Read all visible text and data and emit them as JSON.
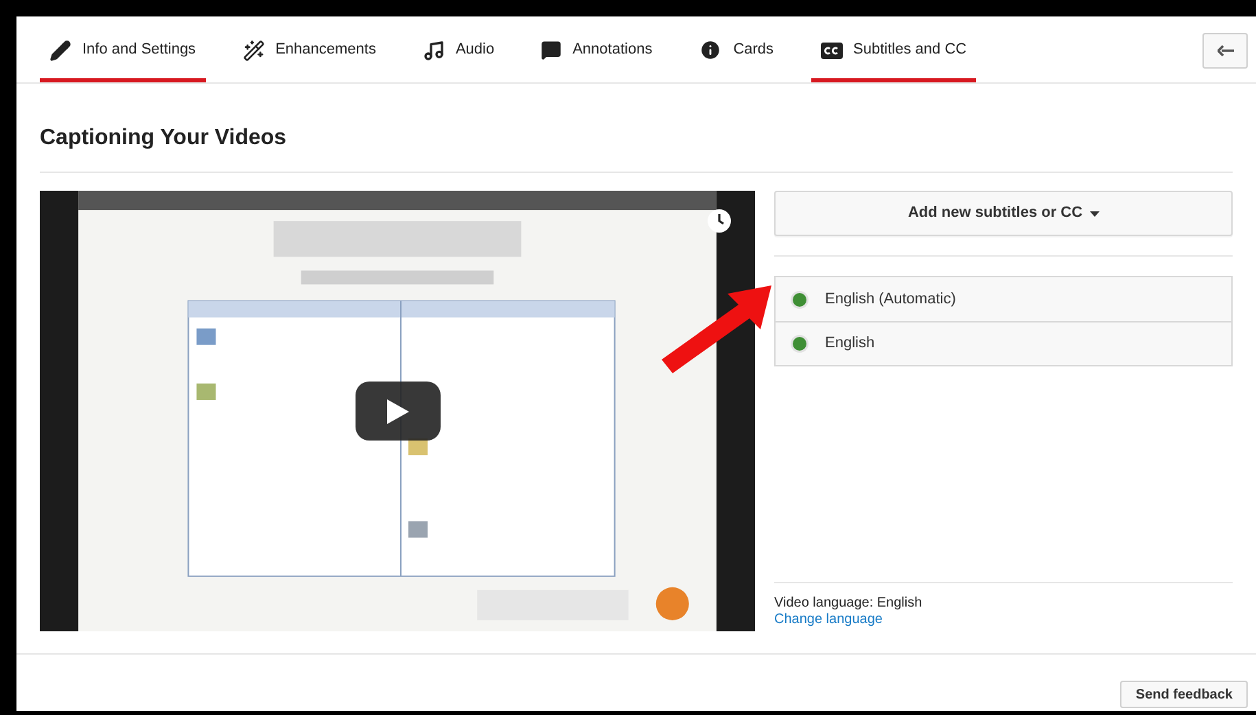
{
  "tabs": [
    {
      "label": "Info and Settings",
      "selected": true
    },
    {
      "label": "Enhancements",
      "selected": false
    },
    {
      "label": "Audio",
      "selected": false
    },
    {
      "label": "Annotations",
      "selected": false
    },
    {
      "label": "Cards",
      "selected": false
    },
    {
      "label": "Subtitles and CC",
      "selected": true
    }
  ],
  "page_title": "Captioning Your Videos",
  "add_button": "Add new subtitles or CC",
  "tracks": [
    {
      "label": "English (Automatic)"
    },
    {
      "label": "English"
    }
  ],
  "video_language": "Video language: English",
  "change_language": "Change language",
  "send_feedback": "Send feedback"
}
